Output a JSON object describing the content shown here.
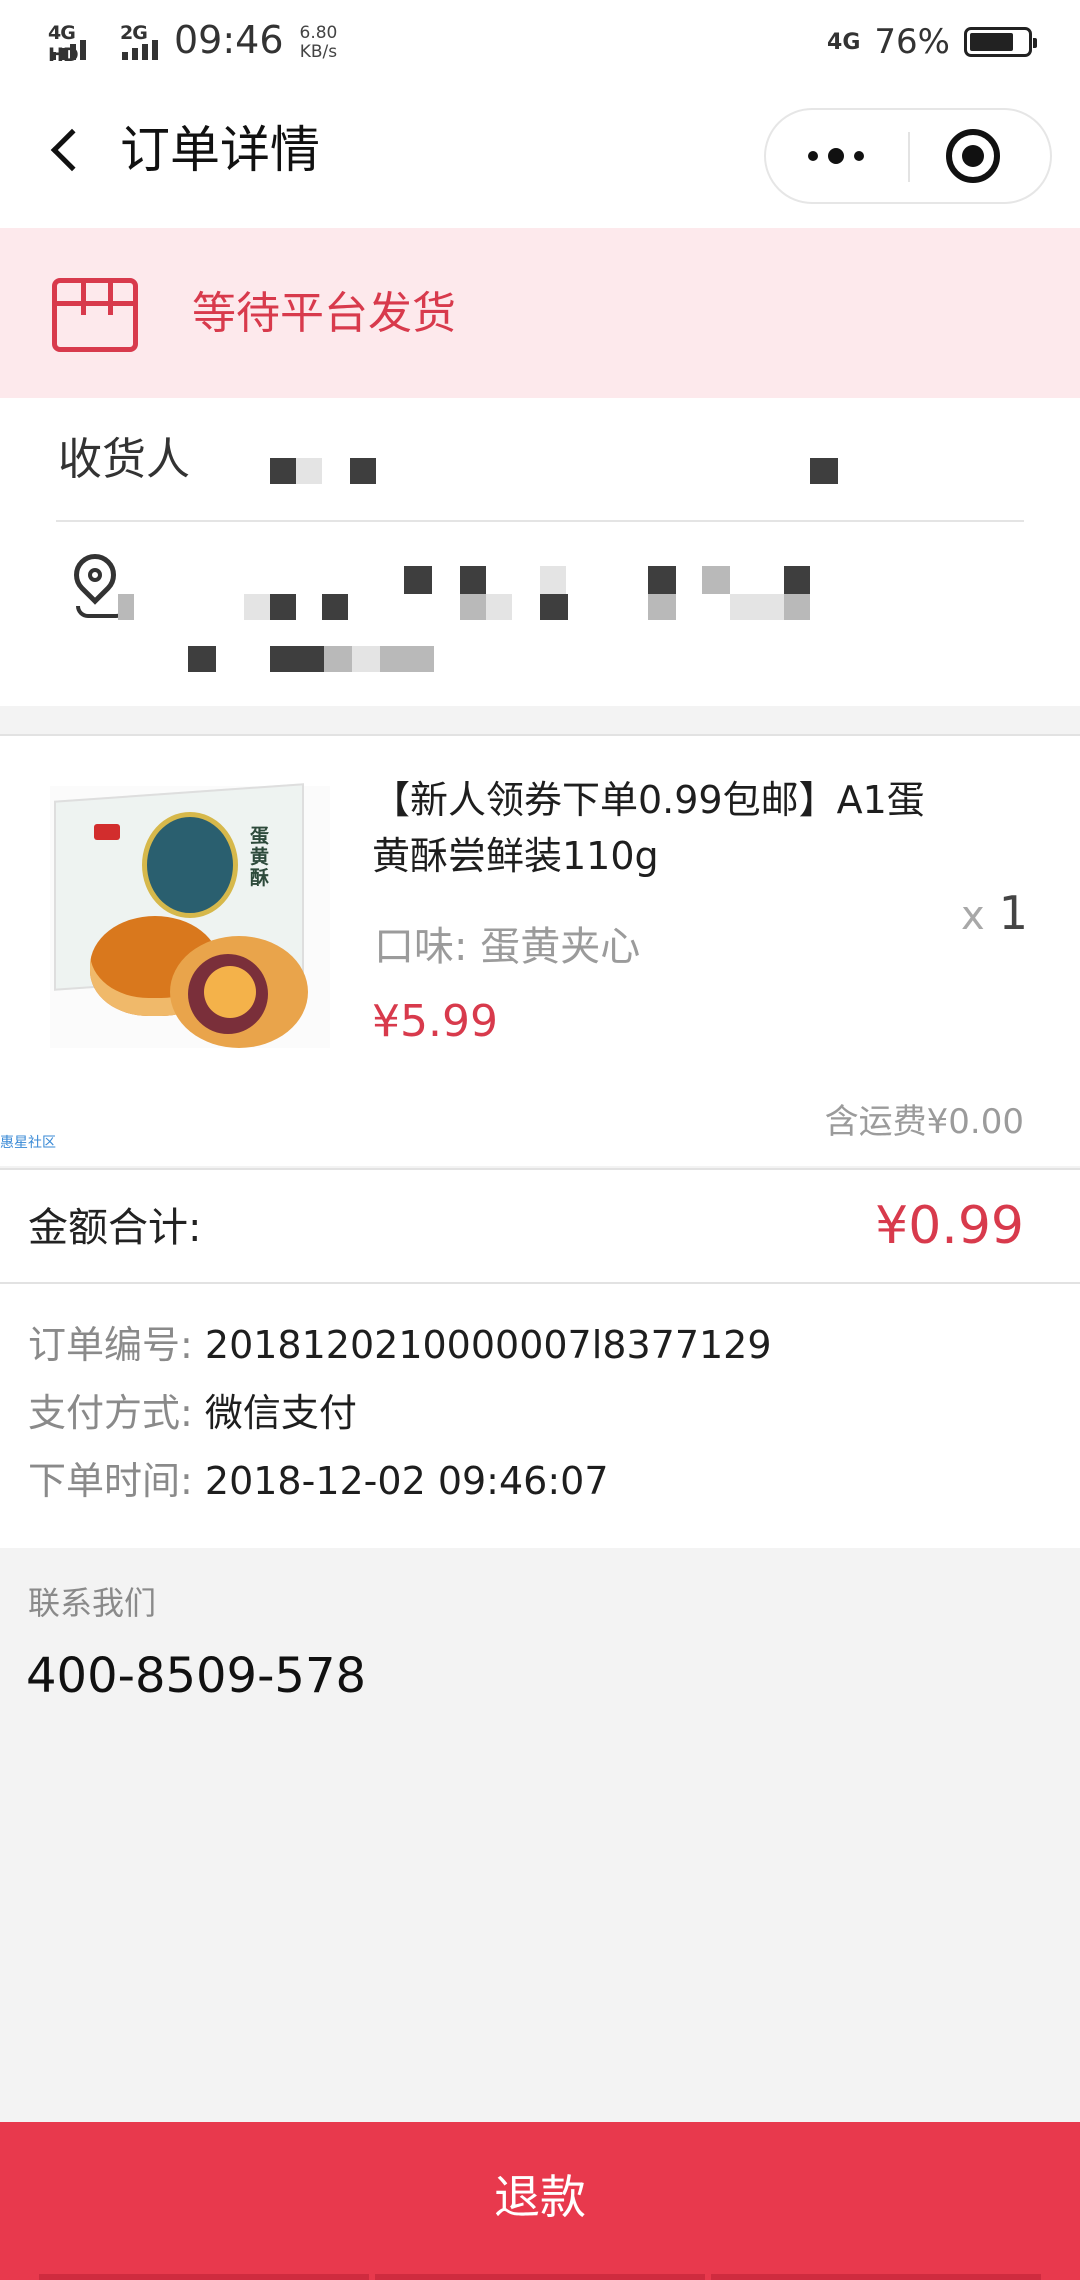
{
  "status_bar": {
    "net1": "4G HD",
    "net2": "2G",
    "time": "09:46",
    "speed_value": "6.80",
    "speed_unit": "KB/s",
    "net_right": "4G",
    "battery_pct": "76%",
    "battery_level": 0.76
  },
  "nav": {
    "title": "订单详情"
  },
  "order_status": {
    "text": "等待平台发货",
    "icon": "parcel-icon"
  },
  "receiver": {
    "label": "收货人",
    "location_icon": "location-pin-icon"
  },
  "product": {
    "title": "【新人领券下单0.99包邮】A1蛋黄酥尝鲜装110g",
    "flavor": "口味: 蛋黄夹心",
    "price": "¥5.99",
    "qty_prefix": "x",
    "qty": "1",
    "image_text": "蛋黄酥",
    "watermark": "惠星社区",
    "shipping": "含运费¥0.00"
  },
  "total": {
    "label": "金额合计:",
    "value": "¥0.99"
  },
  "order_info": {
    "number_label": "订单编号:",
    "number_value": "2018120210000007l8377129",
    "payment_label": "支付方式:",
    "payment_value": "微信支付",
    "time_label": "下单时间:",
    "time_value": "2018-12-02 09:46:07"
  },
  "contact": {
    "label": "联系我们",
    "phone": "400-8509-578"
  },
  "actions": {
    "refund_label": "退款"
  },
  "colors": {
    "accent": "#d83a4c",
    "refund_bg": "#e8394d",
    "banner_bg": "#fde9ec"
  }
}
